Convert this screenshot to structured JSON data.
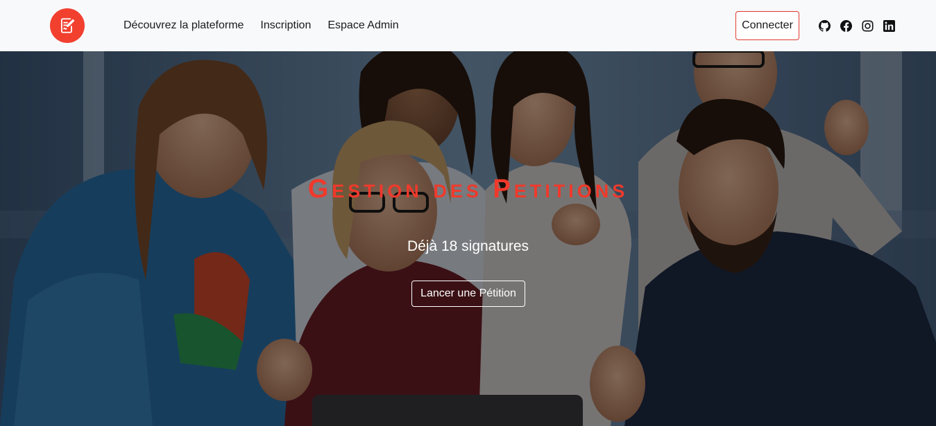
{
  "nav": {
    "logo_icon": "document-edit-icon",
    "links": [
      "Découvrez la plateforme",
      "Inscription",
      "Espace Admin"
    ],
    "connect_label": "Connecter",
    "socials": [
      {
        "icon": "github-icon"
      },
      {
        "icon": "facebook-icon"
      },
      {
        "icon": "instagram-icon"
      },
      {
        "icon": "linkedin-icon"
      }
    ]
  },
  "hero": {
    "title": "Gestion des Petitions",
    "subtitle": "Déjà 18 signatures",
    "cta_label": "Lancer une Pétition"
  },
  "colors": {
    "accent": "#f2402f",
    "title": "#f0392b",
    "navbar_bg": "#f8f9fb",
    "text_dark": "#1a1a1a",
    "text_light": "#ffffff"
  }
}
